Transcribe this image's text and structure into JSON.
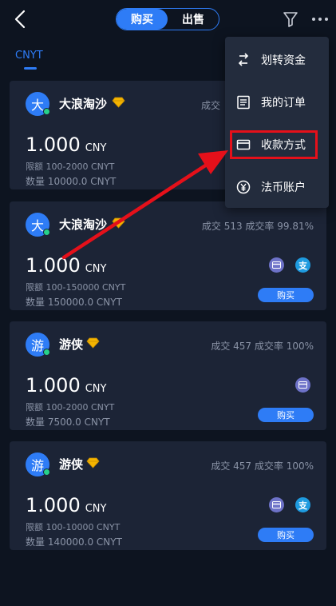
{
  "header": {
    "back_icon": "back-arrow-icon",
    "tabs": [
      {
        "label": "购买",
        "active": true
      },
      {
        "label": "出售",
        "active": false
      }
    ],
    "filter_icon": "filter-funnel-icon",
    "more_icon": "more-dots-icon"
  },
  "currency_tab": {
    "label": "CNYT"
  },
  "colors": {
    "accent": "#2e7cf6",
    "background": "#0d1420",
    "card": "#1c2436",
    "highlight": "#e5101a",
    "online": "#27d18a",
    "diamond": "#f4b400"
  },
  "menu": {
    "items": [
      {
        "label": "划转资金",
        "icon": "transfer-icon"
      },
      {
        "label": "我的订单",
        "icon": "orders-list-icon"
      },
      {
        "label": "收款方式",
        "icon": "payment-card-icon",
        "highlighted": true
      },
      {
        "label": "法币账户",
        "icon": "yuan-account-icon"
      }
    ]
  },
  "listings": [
    {
      "avatar": "大",
      "name": "大浪淘沙",
      "stats": "成交",
      "price": "1.000",
      "unit": "CNY",
      "limit": "限额   100-2000 CNYT",
      "qty": "数量   10000.0 CNYT",
      "payments": [],
      "buy_label": ""
    },
    {
      "avatar": "大",
      "name": "大浪淘沙",
      "stats": "成交 513  成交率 99.81%",
      "price": "1.000",
      "unit": "CNY",
      "limit": "限额   100-150000 CNYT",
      "qty": "数量   150000.0 CNYT",
      "payments": [
        "bank-card-icon",
        "alipay-icon"
      ],
      "buy_label": "购买"
    },
    {
      "avatar": "游",
      "name": "游侠",
      "stats": "成交 457  成交率 100%",
      "price": "1.000",
      "unit": "CNY",
      "limit": "限额   100-2000 CNYT",
      "qty": "数量   7500.0 CNYT",
      "payments": [
        "bank-card-icon"
      ],
      "buy_label": "购买"
    },
    {
      "avatar": "游",
      "name": "游侠",
      "stats": "成交 457  成交率 100%",
      "price": "1.000",
      "unit": "CNY",
      "limit": "限额   100-10000 CNYT",
      "qty": "数量   140000.0 CNYT",
      "payments": [
        "bank-card-icon",
        "alipay-icon"
      ],
      "buy_label": "购买"
    }
  ],
  "alipay_glyph": "支"
}
